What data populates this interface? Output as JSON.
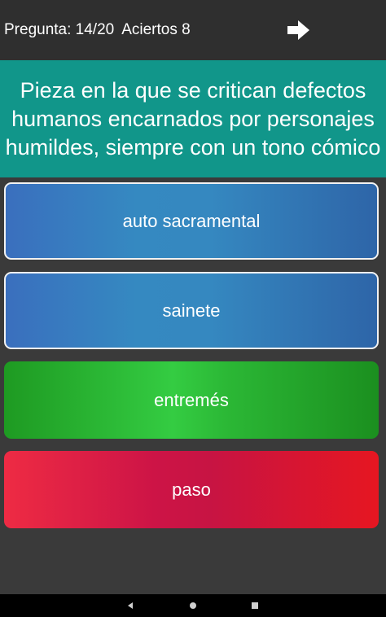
{
  "header": {
    "question_counter": "Pregunta: 14/20",
    "correct_counter": "Aciertos 8",
    "next_icon": "arrow-right-icon"
  },
  "question": {
    "text": "Pieza en la que se critican defectos humanos encarnados por personajes humildes, siempre con un tono cómico"
  },
  "answers": [
    {
      "label": "auto sacramental",
      "color": "#3589c1"
    },
    {
      "label": "sainete",
      "color": "#3589c1"
    },
    {
      "label": "entremés",
      "color": "#34cc42"
    },
    {
      "label": "paso",
      "color": "#cd1446"
    }
  ],
  "navbar": {
    "back_icon": "back-triangle-icon",
    "home_icon": "home-circle-icon",
    "recents_icon": "recents-square-icon"
  },
  "colors": {
    "topbar": "#2f2f2f",
    "question_bg": "#11968a",
    "background": "#3a3a3a"
  }
}
